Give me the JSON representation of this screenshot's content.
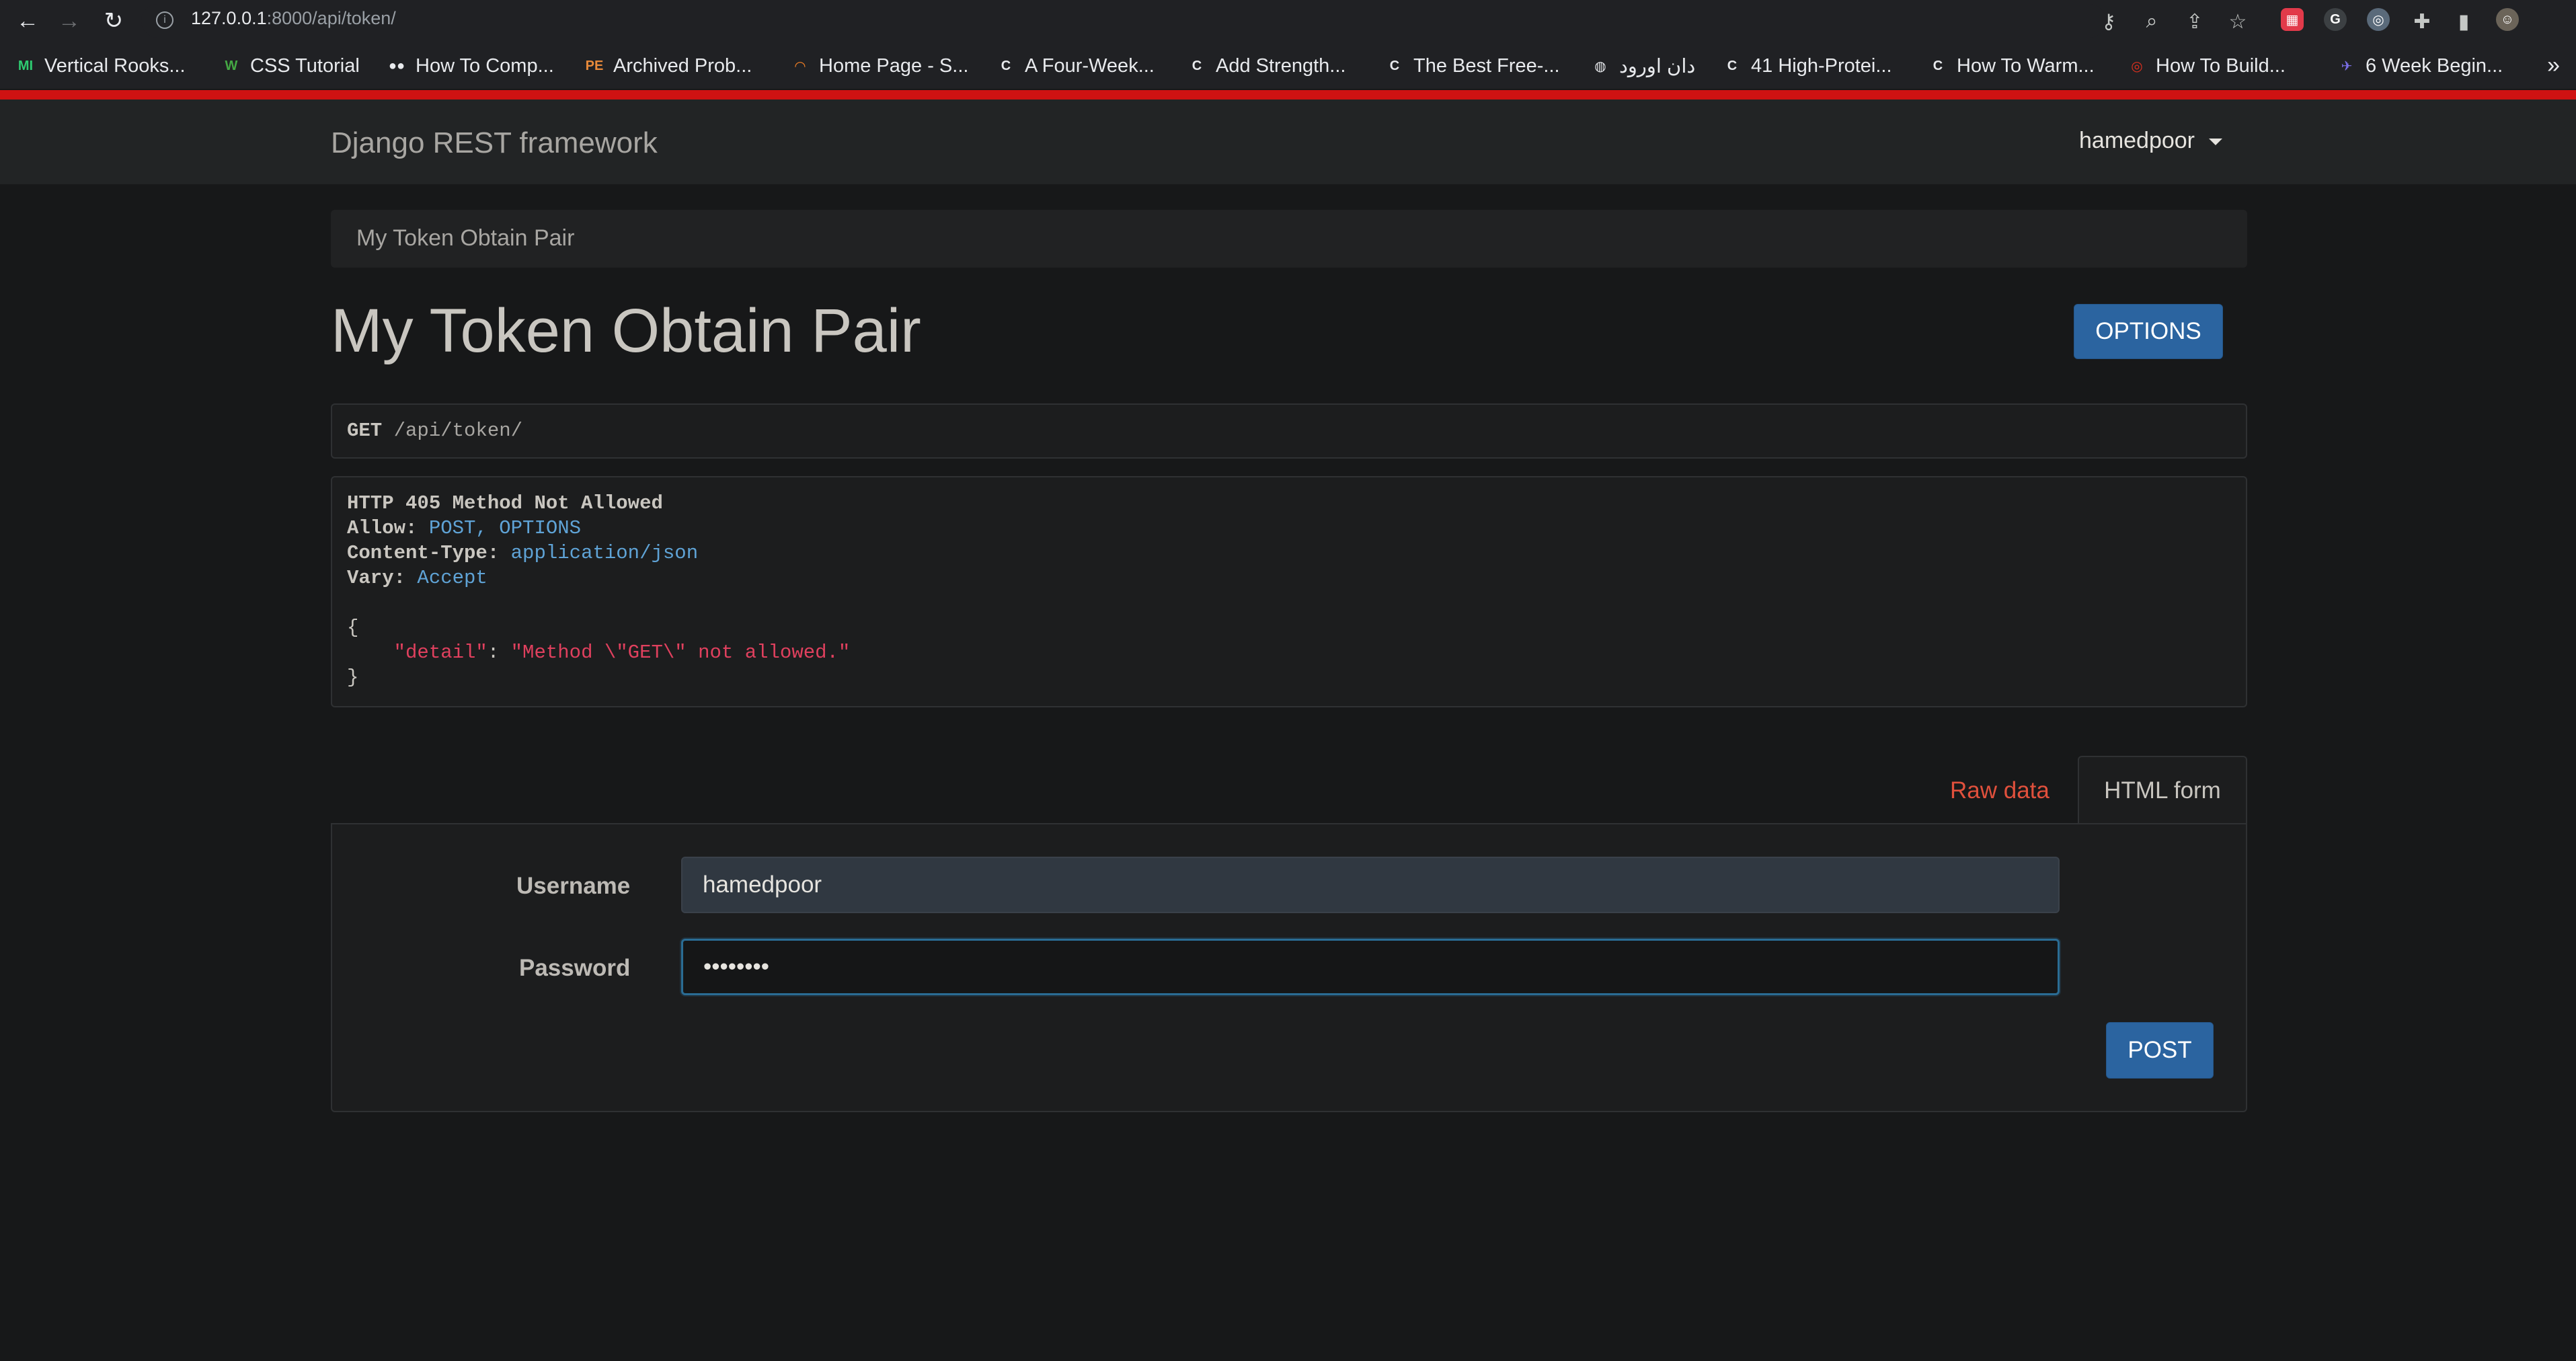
{
  "browser": {
    "url_host": "127.0.0.1",
    "url_rest": ":8000/api/token/",
    "bookmarks": [
      {
        "label": "Vertical Rooks...",
        "icon": "MI",
        "color": "#2ecc71"
      },
      {
        "label": "CSS Tutorial",
        "icon": "W",
        "color": "#44a844"
      },
      {
        "label": "How To Comp...",
        "icon": "●●",
        "color": "#e8eaed"
      },
      {
        "label": "Archived Prob...",
        "icon": "PE",
        "color": "#e88a3a"
      },
      {
        "label": "Home Page - S...",
        "icon": "◠",
        "color": "#f48024"
      },
      {
        "label": "A Four-Week...",
        "icon": "C",
        "color": "#e8eaed"
      },
      {
        "label": "Add Strength...",
        "icon": "C",
        "color": "#e8eaed"
      },
      {
        "label": "The Best Free-...",
        "icon": "C",
        "color": "#e8eaed"
      },
      {
        "label": "دان اورود",
        "icon": "◍",
        "color": "#e8eaed"
      },
      {
        "label": "41 High-Protei...",
        "icon": "C",
        "color": "#e8eaed"
      },
      {
        "label": "How To Warm...",
        "icon": "C",
        "color": "#e8eaed"
      },
      {
        "label": "How To Build...",
        "icon": "◎",
        "color": "#e0301e"
      },
      {
        "label": "6 Week Begin...",
        "icon": "✈",
        "color": "#7a6ee6"
      }
    ],
    "more": "»"
  },
  "navbar": {
    "brand": "Django REST framework",
    "user": "hamedpoor"
  },
  "breadcrumb": "My Token Obtain Pair",
  "title": "My Token Obtain Pair",
  "options_label": "OPTIONS",
  "request": {
    "method": "GET",
    "path": " /api/token/"
  },
  "response": {
    "status": "HTTP 405 Method Not Allowed",
    "allow_key": "Allow:",
    "allow_val": " POST, OPTIONS",
    "ctype_key": "Content-Type:",
    "ctype_val": " application/json",
    "vary_key": "Vary:",
    "vary_val": " Accept",
    "open_brace": "{",
    "detail_key": "    \"detail\"",
    "colon": ": ",
    "detail_val": "\"Method \\\"GET\\\" not allowed.\"",
    "close_brace": "}"
  },
  "tabs": {
    "raw": "Raw data",
    "html": "HTML form"
  },
  "form": {
    "username_label": "Username",
    "username_value": "hamedpoor",
    "password_label": "Password",
    "password_value": "••••••••",
    "submit": "POST"
  },
  "colors": {
    "accent_red": "#cf1212",
    "button_blue": "#2b64a0",
    "link_blue": "#5fa3d6",
    "string_red": "#e0405e"
  }
}
